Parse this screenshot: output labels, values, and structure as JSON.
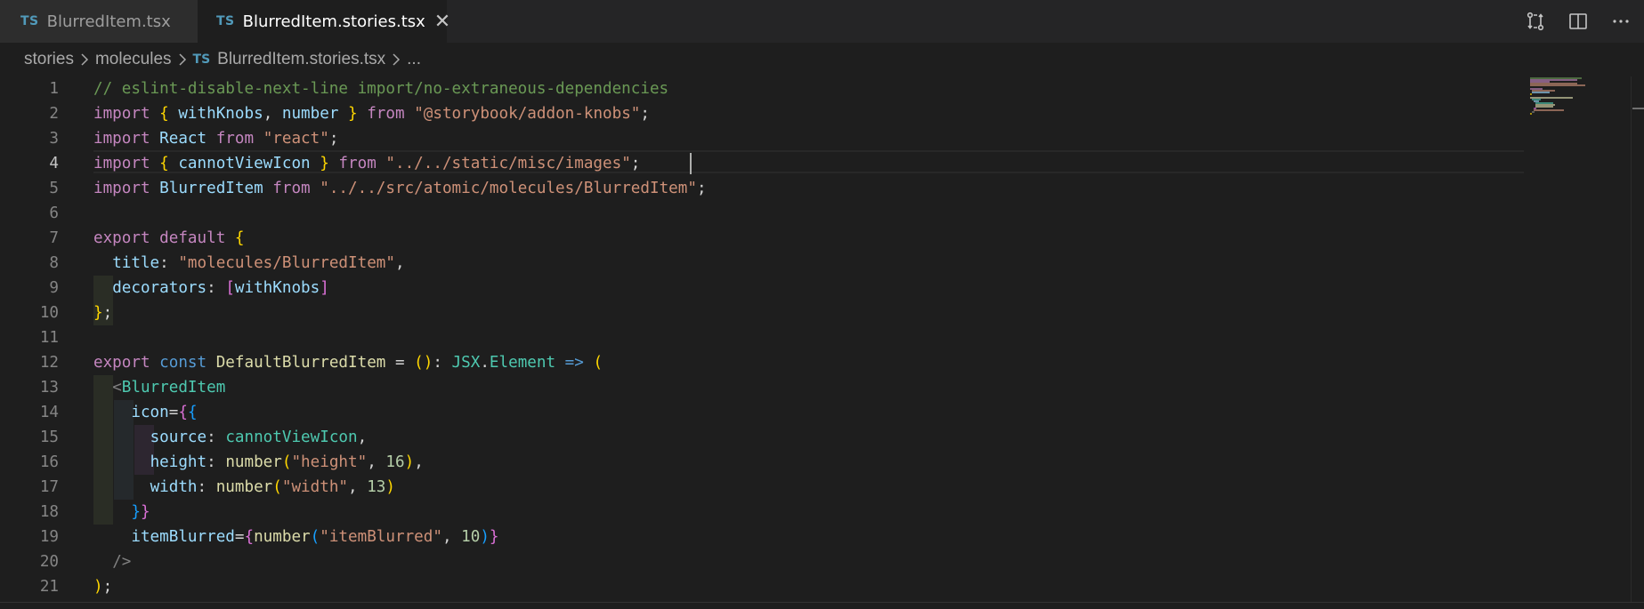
{
  "tabs": [
    {
      "icon": "TS",
      "label": "BlurredItem.tsx",
      "active": false
    },
    {
      "icon": "TS",
      "label": "BlurredItem.stories.tsx",
      "active": true,
      "close": "✕"
    }
  ],
  "breadcrumb": {
    "items": [
      "stories",
      "molecules",
      "BlurredItem.stories.tsx",
      "..."
    ],
    "file_icon": "TS"
  },
  "editor": {
    "active_line": 4,
    "line_numbers": [
      "1",
      "2",
      "3",
      "4",
      "5",
      "6",
      "7",
      "8",
      "9",
      "10",
      "11",
      "12",
      "13",
      "14",
      "15",
      "16",
      "17",
      "18",
      "19",
      "20",
      "21"
    ],
    "lines": [
      [
        [
          "com",
          "// eslint-disable-next-line import/no-extraneous-dependencies"
        ]
      ],
      [
        [
          "kw",
          "import"
        ],
        [
          "p",
          " "
        ],
        [
          "b1",
          "{"
        ],
        [
          "p",
          " "
        ],
        [
          "id",
          "withKnobs"
        ],
        [
          "p",
          ", "
        ],
        [
          "id",
          "number"
        ],
        [
          "p",
          " "
        ],
        [
          "b1",
          "}"
        ],
        [
          "p",
          " "
        ],
        [
          "kw",
          "from"
        ],
        [
          "p",
          " "
        ],
        [
          "str",
          "\"@storybook/addon-knobs\""
        ],
        [
          "p",
          ";"
        ]
      ],
      [
        [
          "kw",
          "import"
        ],
        [
          "p",
          " "
        ],
        [
          "id",
          "React"
        ],
        [
          "p",
          " "
        ],
        [
          "kw",
          "from"
        ],
        [
          "p",
          " "
        ],
        [
          "str",
          "\"react\""
        ],
        [
          "p",
          ";"
        ]
      ],
      [
        [
          "kw",
          "import"
        ],
        [
          "p",
          " "
        ],
        [
          "b1",
          "{"
        ],
        [
          "p",
          " "
        ],
        [
          "id",
          "cannotViewIcon"
        ],
        [
          "p",
          " "
        ],
        [
          "b1",
          "}"
        ],
        [
          "p",
          " "
        ],
        [
          "kw",
          "from"
        ],
        [
          "p",
          " "
        ],
        [
          "str",
          "\"../../static/misc/images\""
        ],
        [
          "p",
          ";"
        ]
      ],
      [
        [
          "kw",
          "import"
        ],
        [
          "p",
          " "
        ],
        [
          "id",
          "BlurredItem"
        ],
        [
          "p",
          " "
        ],
        [
          "kw",
          "from"
        ],
        [
          "p",
          " "
        ],
        [
          "str",
          "\"../../src/atomic/molecules/BlurredItem\""
        ],
        [
          "p",
          ";"
        ]
      ],
      [],
      [
        [
          "kw",
          "export"
        ],
        [
          "p",
          " "
        ],
        [
          "kw",
          "default"
        ],
        [
          "p",
          " "
        ],
        [
          "b1",
          "{"
        ]
      ],
      [
        [
          "p",
          "  "
        ],
        [
          "id",
          "title"
        ],
        [
          "p",
          ": "
        ],
        [
          "str",
          "\"molecules/BlurredItem\""
        ],
        [
          "p",
          ","
        ]
      ],
      [
        [
          "p",
          "  "
        ],
        [
          "id",
          "decorators"
        ],
        [
          "p",
          ": "
        ],
        [
          "b2",
          "["
        ],
        [
          "id",
          "withKnobs"
        ],
        [
          "b2",
          "]"
        ]
      ],
      [
        [
          "b1",
          "}"
        ],
        [
          "p",
          ";"
        ]
      ],
      [],
      [
        [
          "kw",
          "export"
        ],
        [
          "p",
          " "
        ],
        [
          "kw2",
          "const"
        ],
        [
          "p",
          " "
        ],
        [
          "fn",
          "DefaultBlurredItem"
        ],
        [
          "p",
          " = "
        ],
        [
          "b1",
          "()"
        ],
        [
          "p",
          ": "
        ],
        [
          "type",
          "JSX"
        ],
        [
          "p",
          "."
        ],
        [
          "type",
          "Element"
        ],
        [
          "p",
          " "
        ],
        [
          "kw2",
          "=>"
        ],
        [
          "p",
          " "
        ],
        [
          "b1",
          "("
        ]
      ],
      [
        [
          "p",
          "  "
        ],
        [
          "tag",
          "<"
        ],
        [
          "type",
          "BlurredItem"
        ]
      ],
      [
        [
          "p",
          "    "
        ],
        [
          "id",
          "icon"
        ],
        [
          "p",
          "="
        ],
        [
          "b2",
          "{"
        ],
        [
          "b3",
          "{"
        ]
      ],
      [
        [
          "p",
          "      "
        ],
        [
          "id",
          "source"
        ],
        [
          "p",
          ": "
        ],
        [
          "type",
          "cannotViewIcon"
        ],
        [
          "p",
          ","
        ]
      ],
      [
        [
          "p",
          "      "
        ],
        [
          "id",
          "height"
        ],
        [
          "p",
          ": "
        ],
        [
          "fn",
          "number"
        ],
        [
          "b1",
          "("
        ],
        [
          "str",
          "\"height\""
        ],
        [
          "p",
          ", "
        ],
        [
          "num",
          "16"
        ],
        [
          "b1",
          ")"
        ],
        [
          "p",
          ","
        ]
      ],
      [
        [
          "p",
          "      "
        ],
        [
          "id",
          "width"
        ],
        [
          "p",
          ": "
        ],
        [
          "fn",
          "number"
        ],
        [
          "b1",
          "("
        ],
        [
          "str",
          "\"width\""
        ],
        [
          "p",
          ", "
        ],
        [
          "num",
          "13"
        ],
        [
          "b1",
          ")"
        ]
      ],
      [
        [
          "p",
          "    "
        ],
        [
          "b3",
          "}"
        ],
        [
          "b2",
          "}"
        ]
      ],
      [
        [
          "p",
          "    "
        ],
        [
          "id",
          "itemBlurred"
        ],
        [
          "p",
          "="
        ],
        [
          "b2",
          "{"
        ],
        [
          "fn",
          "number"
        ],
        [
          "b3",
          "("
        ],
        [
          "str",
          "\"itemBlurred\""
        ],
        [
          "p",
          ", "
        ],
        [
          "num",
          "10"
        ],
        [
          "b3",
          ")"
        ],
        [
          "b2",
          "}"
        ]
      ],
      [
        [
          "p",
          "  "
        ],
        [
          "tag",
          "/>"
        ]
      ],
      [
        [
          "b1",
          ")"
        ],
        [
          "p",
          ";"
        ]
      ]
    ]
  },
  "colors": {
    "background": "#1e1e1e",
    "tabbar": "#252526",
    "accent": "#519aba"
  }
}
